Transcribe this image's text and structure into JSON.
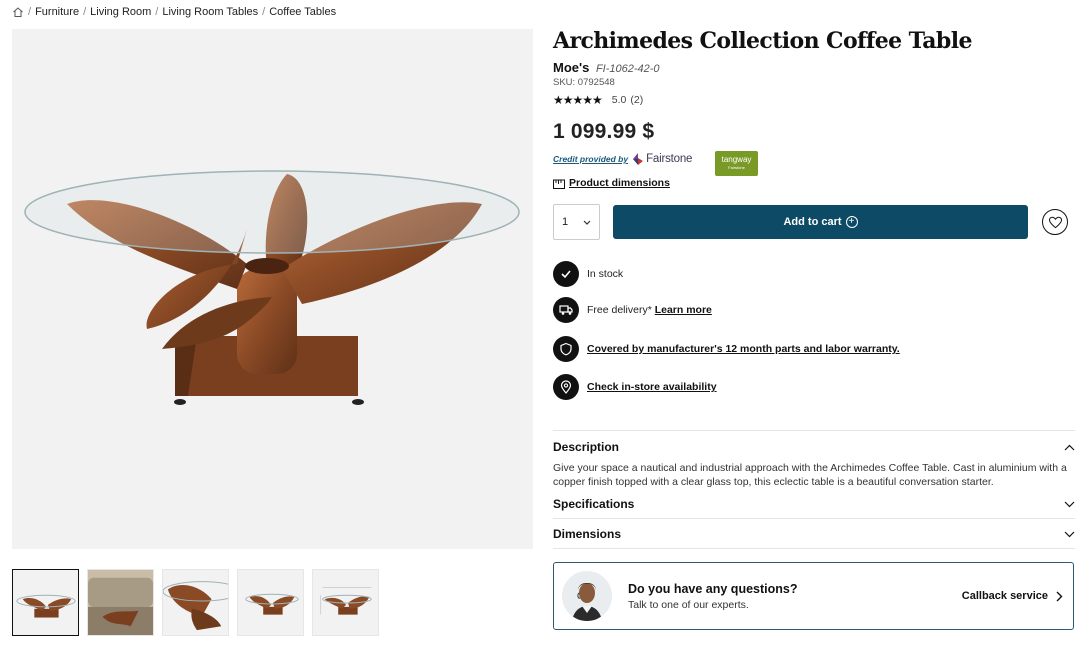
{
  "breadcrumb": {
    "items": [
      "Furniture",
      "Living Room",
      "Living Room Tables",
      "Coffee Tables"
    ]
  },
  "product": {
    "title": "Archimedes Collection Coffee Table",
    "brand": "Moe's",
    "model": "FI-1062-42-0",
    "sku": "SKU: 0792548",
    "rating": "5.0",
    "review_count": "(2)",
    "stars": "★★★★★",
    "price": "1 099.99 $"
  },
  "financing": {
    "credit_text": "Credit provided by",
    "provider": "Fairstone",
    "badge_line1": "tangway",
    "badge_line2": "Fairstone"
  },
  "dimensions_link": "Product dimensions",
  "purchase": {
    "quantity": "1",
    "add_to_cart": "Add to cart"
  },
  "features": {
    "stock": "In stock",
    "delivery_text": "Free delivery*",
    "delivery_link": "Learn more",
    "warranty": "Covered by manufacturer's 12 month parts and labor warranty.",
    "store": "Check in-store availability"
  },
  "accordion": {
    "description_title": "Description",
    "description_text": "Give your space a nautical and industrial approach with the Archimedes Coffee Table. Cast in aluminium with a copper finish topped with a clear glass top, this eclectic table is a beautiful conversation starter.",
    "specifications_title": "Specifications",
    "dimensions_title": "Dimensions"
  },
  "callback": {
    "question": "Do you have any questions?",
    "subtext": "Talk to one of our experts.",
    "service": "Callback service"
  },
  "colors": {
    "cart_button": "#0d4a66",
    "callback_border": "#2c5a6e",
    "tangway_badge": "#7a9a28"
  }
}
